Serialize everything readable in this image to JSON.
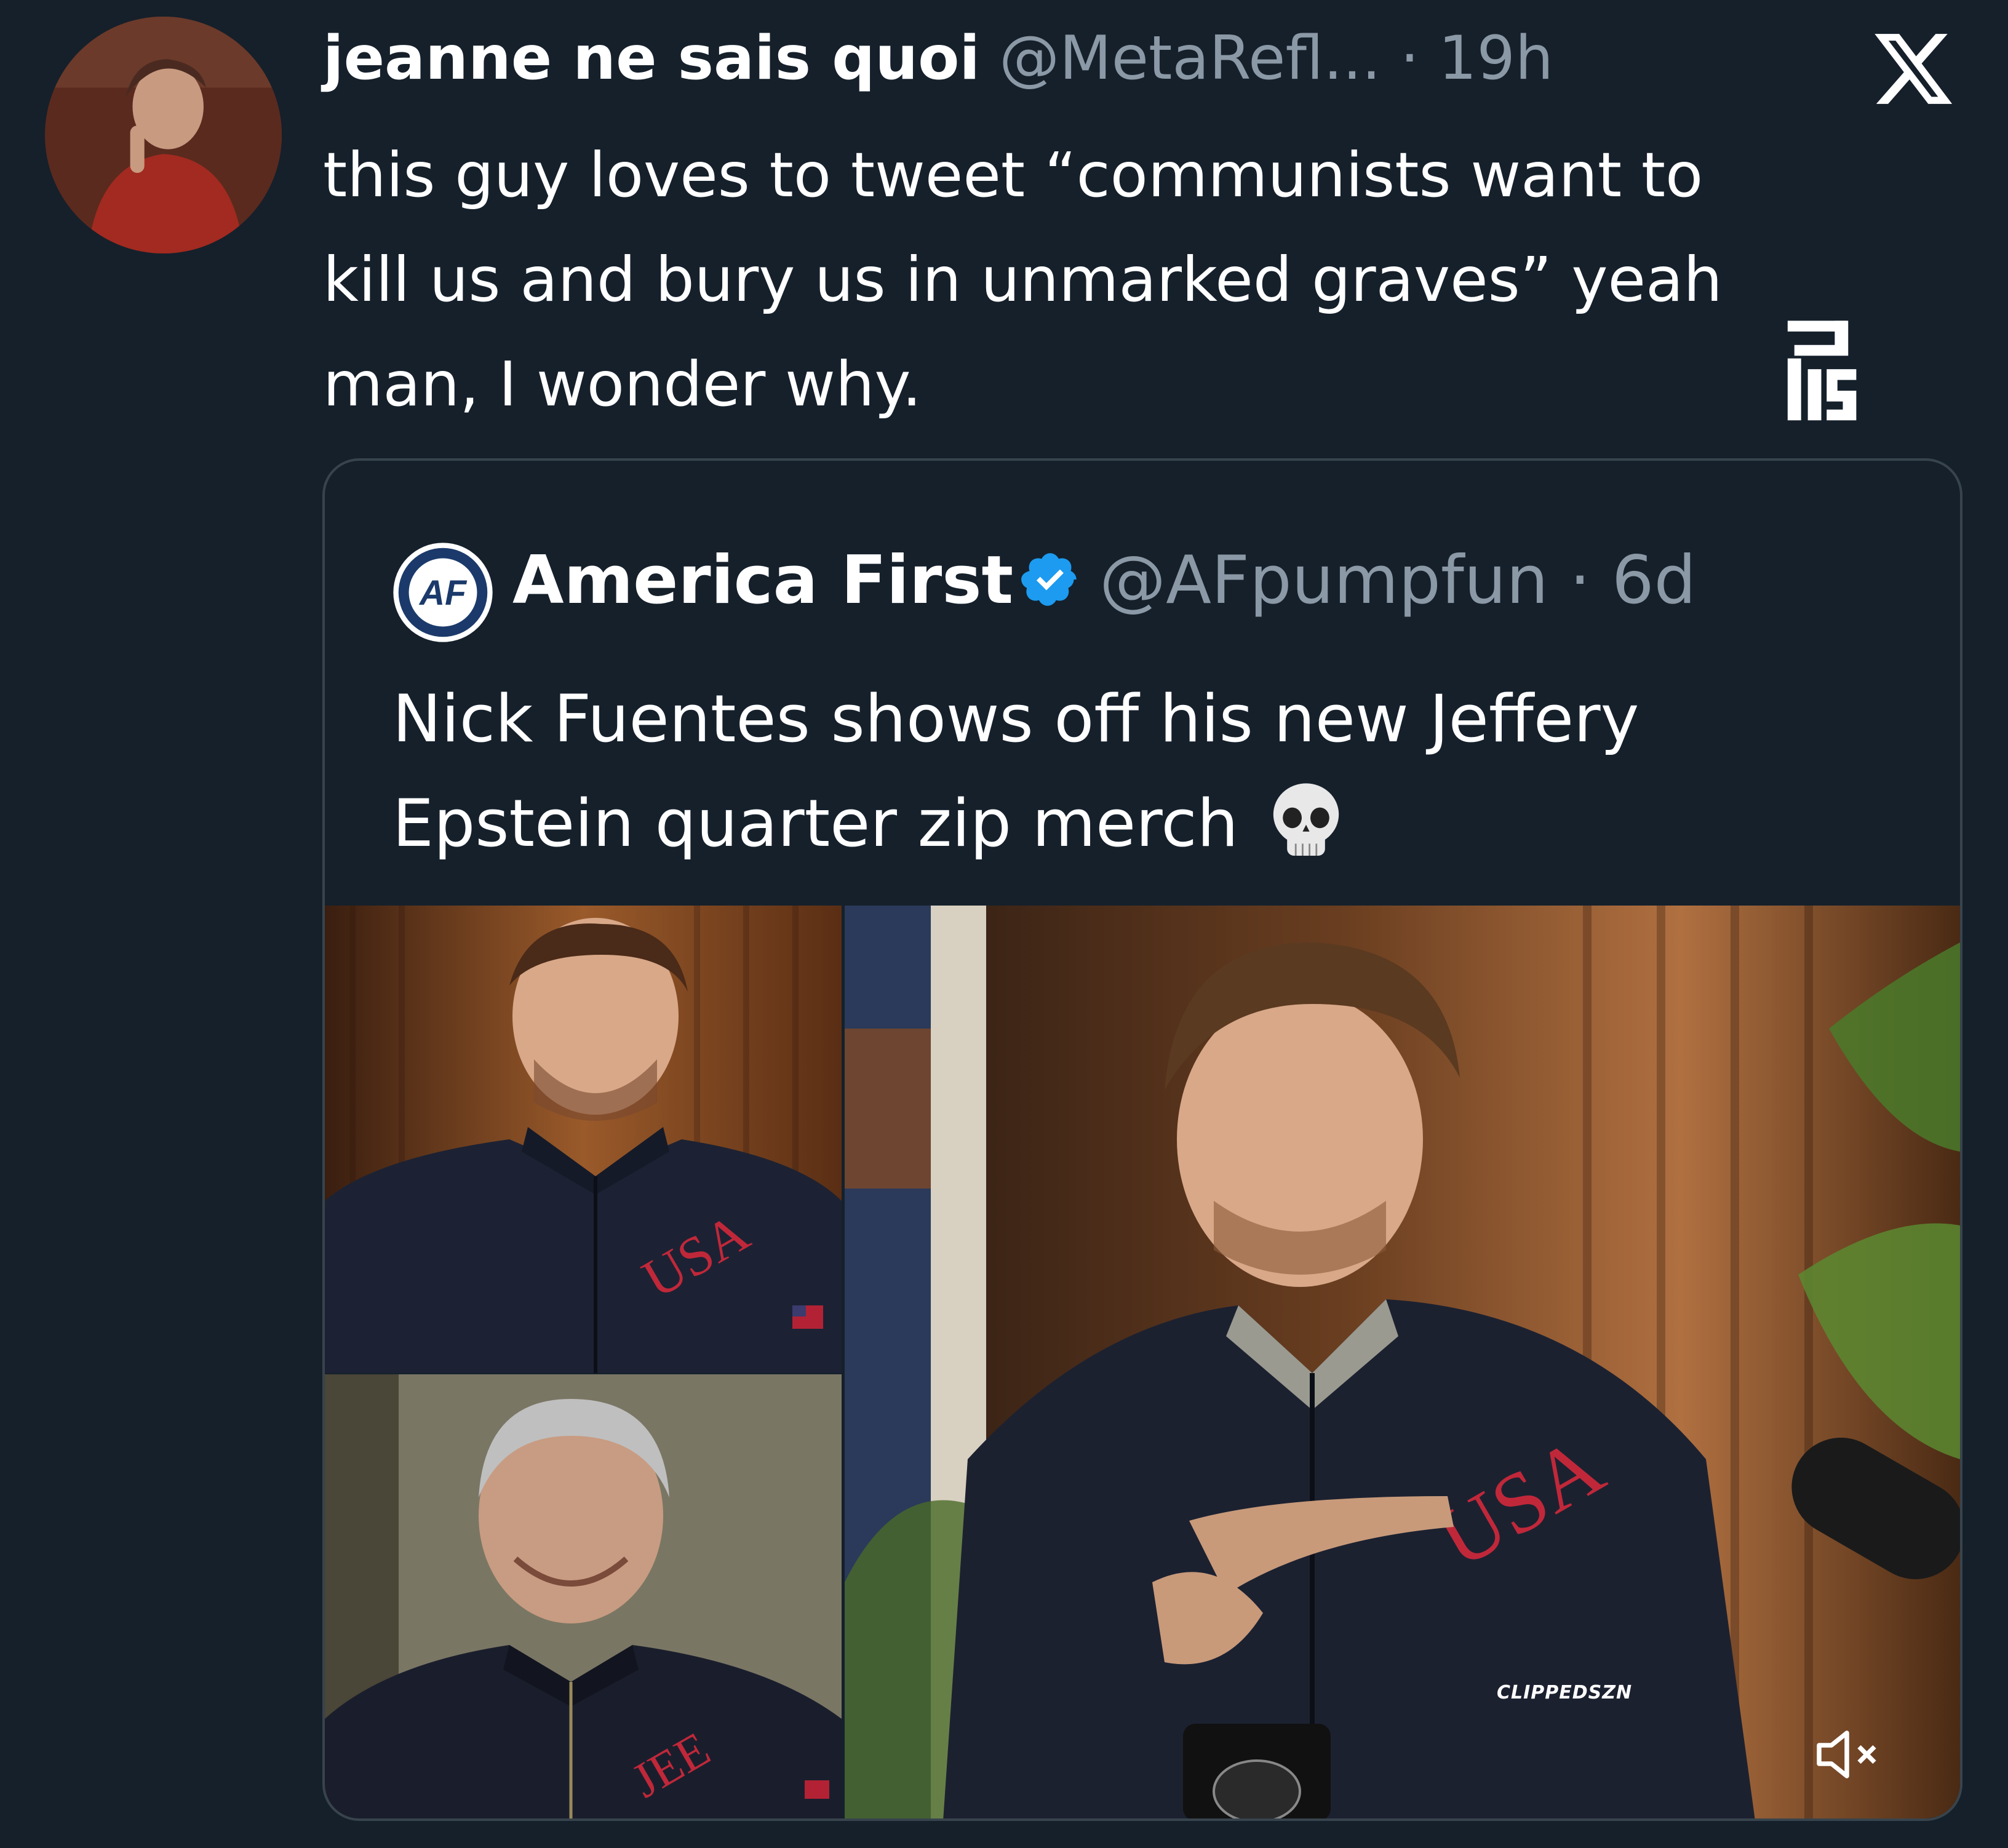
{
  "tweet": {
    "display_name": "jeanne ne sais quoi",
    "handle": "@MetaRefl...",
    "separator": "·",
    "time": "19h",
    "text": "this guy loves to tweet “communists want to\nkill us and bury us in unmarked graves” yeah\nman, I wonder why."
  },
  "quoted": {
    "display_name": "America First",
    "avatar_text": "AF",
    "verified": true,
    "handle": "@AFpumpfun",
    "separator": "·",
    "time": "6d",
    "text": "Nick Fuentes shows off his new Jeffery Epstein quarter zip merch",
    "emoji": "skull",
    "media": {
      "overlay_label": "CLIPPEDSZN",
      "mute_icon": "speaker-muted-icon"
    }
  },
  "icons": [
    "x-logo-icon",
    "verified-badge-icon",
    "skull-emoji-icon",
    "speaker-muted-icon"
  ],
  "colors": {
    "background": "#15202b",
    "text_primary": "#ffffff",
    "text_secondary": "#8b98a5",
    "verified_blue": "#1d9bf0",
    "card_border": "#38444d"
  }
}
